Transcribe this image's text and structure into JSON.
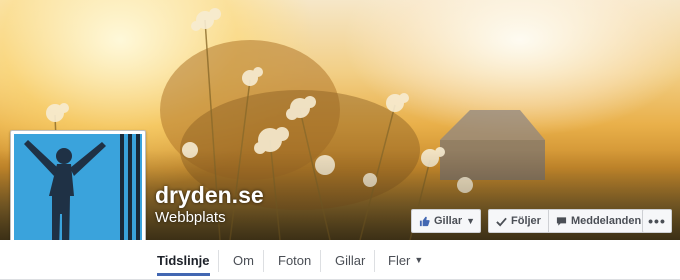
{
  "page": {
    "name": "dryden.se",
    "category": "Webbplats"
  },
  "actions": {
    "like_label": "Gillar",
    "follow_label": "Följer",
    "message_label": "Meddelanden",
    "more_label": "•••"
  },
  "nav": {
    "tabs": [
      {
        "label": "Tidslinje",
        "active": true
      },
      {
        "label": "Om"
      },
      {
        "label": "Foton"
      },
      {
        "label": "Gillar"
      },
      {
        "label": "Fler"
      }
    ],
    "more_caret": "▼"
  },
  "colors": {
    "accent": "#4267b2",
    "profile_bg": "#3aa3dc",
    "like_icon": "#4267b2"
  },
  "icons": {
    "like": "thumbs-up-icon",
    "follow": "check-icon",
    "message": "chat-bubble-icon",
    "dropdown": "chevron-down-icon"
  }
}
